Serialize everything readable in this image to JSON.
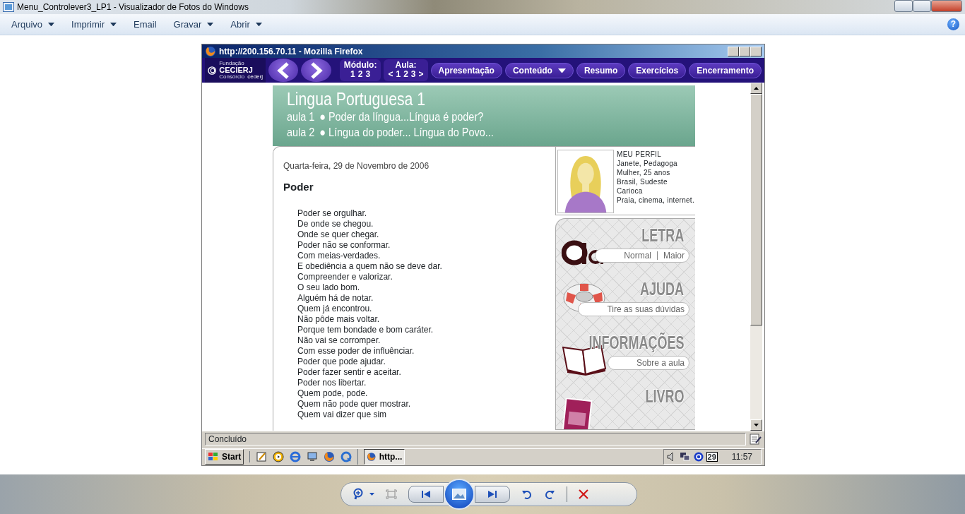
{
  "viewer": {
    "title": "Menu_Controlever3_LP1 - Visualizador de Fotos do Windows",
    "menu": [
      {
        "label": "Arquivo",
        "dropdown": true
      },
      {
        "label": "Imprimir",
        "dropdown": true
      },
      {
        "label": "Email",
        "dropdown": false
      },
      {
        "label": "Gravar",
        "dropdown": true
      },
      {
        "label": "Abrir",
        "dropdown": true
      }
    ],
    "help": "?"
  },
  "browser": {
    "title": "http://200.156.70.11 - Mozilla Firefox",
    "logo": {
      "top": "Fundação",
      "name": "CECIERJ",
      "bottom": "Consórcio",
      "brand": "cederj"
    },
    "modulo": {
      "label": "Módulo:",
      "items": [
        "1",
        "2",
        "3"
      ]
    },
    "aula": {
      "label": "Aula:",
      "items": [
        "<",
        "1",
        "2",
        "3",
        ">"
      ]
    },
    "menu": [
      {
        "label": "Apresentação",
        "dropdown": false
      },
      {
        "label": "Conteúdo",
        "dropdown": true
      },
      {
        "label": "Resumo",
        "dropdown": false
      },
      {
        "label": "Exercícios",
        "dropdown": false
      },
      {
        "label": "Encerramento",
        "dropdown": false
      }
    ],
    "status": "Concluído"
  },
  "page": {
    "course": "Lingua Portuguesa 1",
    "lessons": [
      {
        "number": "aula 1",
        "title": "● Poder da língua...Língua é poder?"
      },
      {
        "number": "aula 2",
        "title": "● Língua do poder... Língua do Povo..."
      }
    ],
    "date": "Quarta-feira, 29 de Novembro de 2006",
    "post_title": "Poder",
    "poem": [
      "Poder se orgulhar.",
      "De onde se chegou.",
      "Onde se quer chegar.",
      "Poder não se conformar.",
      "Com meias-verdades.",
      "E obediência a quem não se deve dar.",
      "Compreender e valorizar.",
      "O seu lado bom.",
      "Alguém há de notar.",
      "Quem já encontrou.",
      "Não pôde mais voltar.",
      "Porque tem bondade e bom caráter.",
      "Não vai se corromper.",
      "Com esse poder de influênciar.",
      "Poder que pode ajudar.",
      "Poder fazer sentir e aceitar.",
      "Poder nos libertar.",
      "Quem pode, pode.",
      "Quem não pode quer mostrar.",
      "Quem vai dizer que sim"
    ],
    "profile": {
      "heading": "MEU PERFIL",
      "lines": [
        "Janete, Pedagoga",
        "Mulher, 25 anos",
        "Brasil, Sudeste",
        "Carioca",
        "Praia, cinema, internet."
      ]
    },
    "tools": [
      {
        "kind": "font",
        "title": "LETRA",
        "links": [
          "Normal",
          "Maior"
        ]
      },
      {
        "kind": "help",
        "title": "AJUDA",
        "links": [
          "Tire as suas dúvidas"
        ]
      },
      {
        "kind": "info",
        "title": "INFORMAÇÕES",
        "links": [
          "Sobre a aula"
        ]
      },
      {
        "kind": "book",
        "title": "LIVRO"
      }
    ]
  },
  "taskbar": {
    "start": "Start",
    "tasks": [
      {
        "label": "http...",
        "selected": true
      }
    ],
    "tray_date": "29",
    "clock": "11:57"
  }
}
